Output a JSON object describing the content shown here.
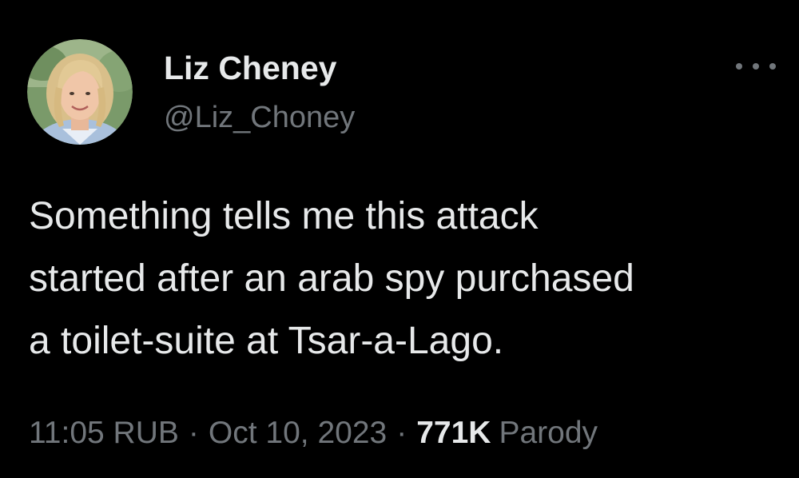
{
  "tweet": {
    "author": {
      "display_name": "Liz Cheney",
      "handle": "@Liz_Choney"
    },
    "text_lines": [
      "Something tells me this attack",
      "started after an arab spy purchased",
      "a toilet-suite at Tsar-a-Lago."
    ],
    "meta": {
      "time": "11:05 RUB",
      "separator": "·",
      "date": "Oct 10, 2023",
      "views_count": "771K",
      "views_label": "Parody"
    },
    "more_icon": "more-horizontal-icon"
  },
  "colors": {
    "background": "#000000",
    "primary_text": "#e7e9ea",
    "secondary_text": "#71767b"
  }
}
